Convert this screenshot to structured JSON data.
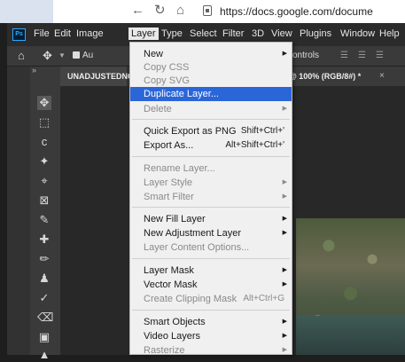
{
  "browser": {
    "url": "https://docs.google.com/docume"
  },
  "app": {
    "logo": "Ps",
    "menus": [
      "File",
      "Edit",
      "Image",
      "Layer",
      "Type",
      "Select",
      "Filter",
      "3D",
      "View",
      "Plugins",
      "Window",
      "Help"
    ],
    "active_menu": "Layer"
  },
  "options_bar": {
    "auto_label": "Au",
    "controls_label": "ontrols"
  },
  "tabs": {
    "tab1": "UNADJUSTEDNO",
    "tab2": "@ 100% (RGB/8#) *",
    "tab2_close": "×"
  },
  "layer_menu": {
    "new": "New",
    "copy_css": "Copy CSS",
    "copy_svg": "Copy SVG",
    "duplicate_layer": "Duplicate Layer...",
    "delete": "Delete",
    "quick_export": "Quick Export as PNG",
    "quick_export_sc": "Shift+Ctrl+'",
    "export_as": "Export As...",
    "export_as_sc": "Alt+Shift+Ctrl+'",
    "rename_layer": "Rename Layer...",
    "layer_style": "Layer Style",
    "smart_filter": "Smart Filter",
    "new_fill_layer": "New Fill Layer",
    "new_adjustment_layer": "New Adjustment Layer",
    "layer_content_options": "Layer Content Options...",
    "layer_mask": "Layer Mask",
    "vector_mask": "Vector Mask",
    "create_clipping_mask": "Create Clipping Mask",
    "create_clipping_mask_sc": "Alt+Ctrl+G",
    "smart_objects": "Smart Objects",
    "video_layers": "Video Layers",
    "rasterize": "Rasterize"
  },
  "colors": {
    "highlight": "#2b66d9",
    "menu_bg": "#f0f0f0",
    "app_bg": "#323232"
  }
}
